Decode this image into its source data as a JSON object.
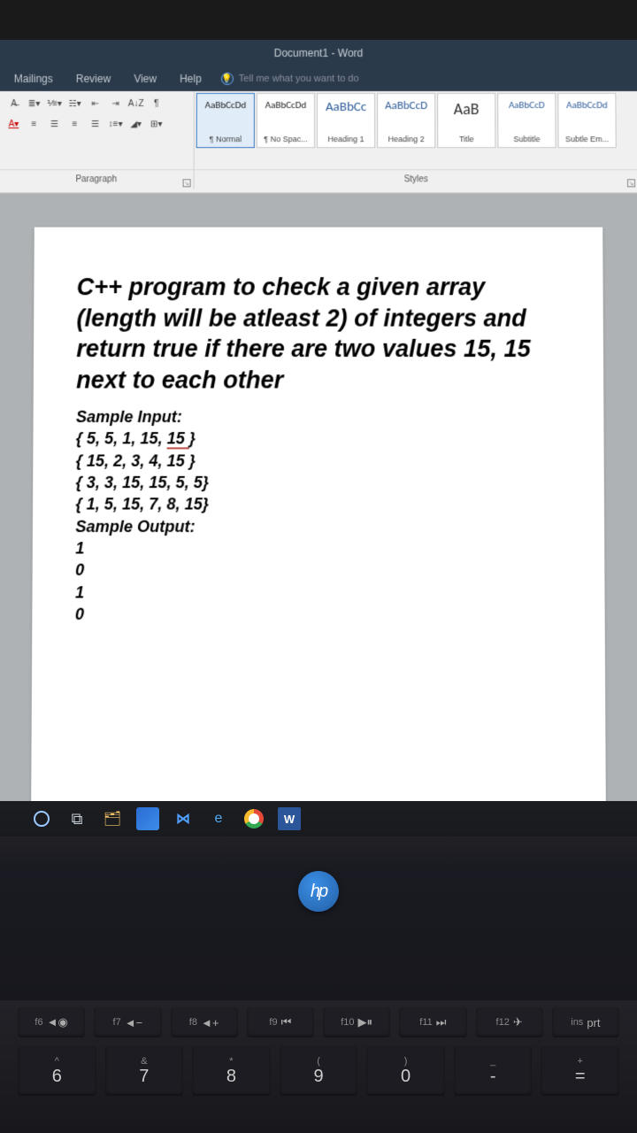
{
  "titlebar": "Document1 - Word",
  "tabs": {
    "mailings": "Mailings",
    "review": "Review",
    "view": "View",
    "help": "Help",
    "tellme": "Tell me what you want to do"
  },
  "styles": [
    {
      "preview": "AaBbCcDd",
      "label": "¶ Normal",
      "cls": "norm",
      "selected": true
    },
    {
      "preview": "AaBbCcDd",
      "label": "¶ No Spac...",
      "cls": "norm"
    },
    {
      "preview": "AaBbCc",
      "label": "Heading 1",
      "cls": "h1"
    },
    {
      "preview": "AaBbCcD",
      "label": "Heading 2",
      "cls": "h2"
    },
    {
      "preview": "AaB",
      "label": "Title",
      "cls": "title"
    },
    {
      "preview": "AaBbCcD",
      "label": "Subtitle",
      "cls": "sub"
    },
    {
      "preview": "AaBbCcDd",
      "label": "Subtle Em...",
      "cls": "sub"
    }
  ],
  "group_labels": {
    "paragraph": "Paragraph",
    "styles": "Styles"
  },
  "document": {
    "title": "C++ program to check a given array (length will be atleast 2) of integers and return true if there are two values 15, 15 next to each other",
    "sample_input_label": "Sample Input:",
    "inputs": [
      "{ 5, 5, 1, 15, ",
      "{ 15, 2, 3, 4, 15 }",
      "{ 3, 3, 15, 15, 5, 5}",
      "{ 1, 5, 15, 7, 8, 15}"
    ],
    "input0_tail_underlined": "15 ",
    "input0_close": "}",
    "sample_output_label": "Sample Output:",
    "outputs": [
      "1",
      "0",
      "1",
      "0"
    ]
  },
  "hp": "hp",
  "fkeys": [
    {
      "f": "f6",
      "sym": "◄◉"
    },
    {
      "f": "f7",
      "sym": "◄−"
    },
    {
      "f": "f8",
      "sym": "◄+"
    },
    {
      "f": "f9",
      "sym": "⏮"
    },
    {
      "f": "f10",
      "sym": "▶⏸"
    },
    {
      "f": "f11",
      "sym": "⏭"
    },
    {
      "f": "f12",
      "sym": "✈"
    },
    {
      "f": "ins",
      "sym": "prt"
    }
  ],
  "nkeys": [
    {
      "top": "^",
      "bot": "6"
    },
    {
      "top": "&",
      "bot": "7"
    },
    {
      "top": "*",
      "bot": "8"
    },
    {
      "top": "(",
      "bot": "9"
    },
    {
      "top": ")",
      "bot": "0"
    },
    {
      "top": "_",
      "bot": "-"
    },
    {
      "top": "+",
      "bot": "="
    }
  ]
}
